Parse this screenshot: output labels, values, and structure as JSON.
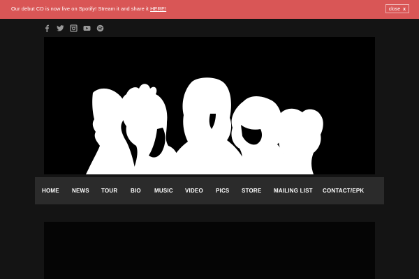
{
  "notice": {
    "text": "Our debut CD is now live on Spotify! Stream it and share it ",
    "link_label": "HERE!",
    "close_label": "close",
    "close_glyph": "x",
    "color": "#d95656"
  },
  "social": [
    {
      "icon": "facebook-icon"
    },
    {
      "icon": "twitter-icon"
    },
    {
      "icon": "instagram-icon"
    },
    {
      "icon": "youtube-icon"
    },
    {
      "icon": "spotify-icon"
    }
  ],
  "nav": {
    "items": [
      {
        "label": "HOME"
      },
      {
        "label": "NEWS"
      },
      {
        "label": "TOUR"
      },
      {
        "label": "BIO"
      },
      {
        "label": "MUSIC"
      },
      {
        "label": "VIDEO"
      },
      {
        "label": "PICS"
      },
      {
        "label": "STORE"
      },
      {
        "label": "MAILING LIST"
      },
      {
        "label": "CONTACT/EPK"
      }
    ]
  },
  "colors": {
    "background": "#141414",
    "nav_background": "#2b2b2b",
    "hero_background": "#000000"
  }
}
